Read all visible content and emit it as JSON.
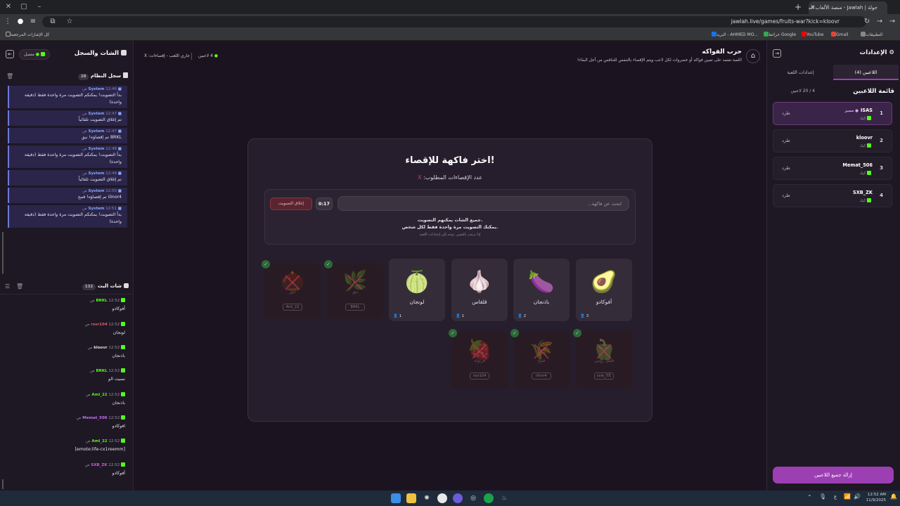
{
  "browser": {
    "tab_title": "جولة | Jawlah - منصة الألعاب الت...",
    "url": "jawlah.live/games/fruits-war?kick=kloovr",
    "bookmarks": [
      "التطبيقات",
      "Gmail",
      "YouTube",
      "خرائط Google",
      "البريد - AHMED MO...",
      "كل الإشارات المرجعية"
    ]
  },
  "left_panel": {
    "title": "الشات والسجل",
    "status": "متصل",
    "system_log_title": "سجل النظام",
    "system_log_count": "28",
    "system_messages": [
      {
        "sender": "System",
        "time": "12:46 ص",
        "text": "بدأ التصويت! يمكنكم التصويت مرة واحدة فقط (دقيقة واحدة)"
      },
      {
        "sender": "System",
        "time": "12:47 ص",
        "text": "تم إغلاق التصويت تلقائياً"
      },
      {
        "sender": "System",
        "time": "12:47 ص",
        "text": "BRKL تم إقصاؤه! نبق"
      },
      {
        "sender": "System",
        "time": "12:48 ص",
        "text": "بدأ التصويت! يمكنكم التصويت مرة واحدة فقط (دقيقة واحدة)"
      },
      {
        "sender": "System",
        "time": "12:49 ص",
        "text": "تم إغلاق التصويت تلقائياً"
      },
      {
        "sender": "System",
        "time": "12:50 ص",
        "text": "ilinor4 تم إقصاؤه! قمح"
      },
      {
        "sender": "System",
        "time": "12:51 ص",
        "text": "بدأ التصويت! يمكنكم التصويت مرة واحدة فقط (دقيقة واحدة)"
      }
    ],
    "live_chat_title": "شات البث",
    "live_chat_count": "132",
    "chat_messages": [
      {
        "user": "BRKL",
        "color": "#53fc18",
        "time": "12:52 ص",
        "text": "أفوكادو"
      },
      {
        "user": "rssr104",
        "color": "#d06060",
        "time": "12:52 ص",
        "text": "لونجان"
      },
      {
        "user": "kloovr",
        "color": "#e0e0e0",
        "time": "12:52 ص",
        "text": "باذنجان"
      },
      {
        "user": "BRKL",
        "color": "#53fc18",
        "time": "12:52 ص",
        "text": "نسيت الو"
      },
      {
        "user": "Aml_22",
        "color": "#53fc18",
        "time": "12:52 ص",
        "text": "باذنجان"
      },
      {
        "user": "Memat_506",
        "color": "#c070f0",
        "time": "12:52 ص",
        "text": "افوكادو"
      },
      {
        "user": "Aml_22",
        "color": "#53fc18",
        "time": "12:52 ص",
        "text": "[emote:life-cx1reemm]"
      },
      {
        "user": "SXB_ZK",
        "color": "#d05ad0",
        "time": "12:52 ص",
        "text": "أفوكادو"
      }
    ]
  },
  "topbar": {
    "game_title": "حرب الفواكه",
    "game_desc": "اللعبة تعتمد على تعيين فواكه أو خضروات لكل لاعب ويتم الإقصاء بالتنفس للتنافس من أجل البقاء!",
    "players_online": "4 لاعبين",
    "status": "جاري اللعب - إقصاءات: X"
  },
  "vote": {
    "heading": "اختر فاكهة للإقصاء!",
    "required_label": "عدد الإقصاءات المطلوب:",
    "required_value": "X",
    "search_placeholder": "ابحث عن فاكهة...",
    "timer": "0:17",
    "close_button": "إغلاق التصويت",
    "note1": "جميع الشات يمكنهم التصويت.",
    "note2": "يمكنك التصويت مرة واحدة فقط لكل شخص.",
    "note3": "إذا ترغب بالتغيير، توجه إلى إعدادات اللعبة"
  },
  "fruits": [
    {
      "name": "أفوكادو",
      "emoji": "🥑",
      "votes": "3"
    },
    {
      "name": "باذنجان",
      "emoji": "🍆",
      "votes": "2"
    },
    {
      "name": "قلقاس",
      "emoji": "🧄",
      "votes": "1"
    },
    {
      "name": "لونجان",
      "emoji": "🍈",
      "votes": "1"
    }
  ],
  "eliminated_row1": [
    {
      "name": "نبق",
      "emoji": "🌿",
      "player": "BRKL"
    },
    {
      "name": "جوز",
      "emoji": "🌰",
      "player": "Aml_22"
    }
  ],
  "eliminated_row2": [
    {
      "name": "فلفل رومي",
      "emoji": "🫑",
      "player": "sxle_ITE"
    },
    {
      "name": "قمح",
      "emoji": "🌾",
      "player": "ilinor4"
    },
    {
      "name": "فراولة",
      "emoji": "🍓",
      "player": "rssr104"
    }
  ],
  "right_panel": {
    "title": "الإعدادات",
    "tab_players": "اللاعبين (4)",
    "tab_settings": "إعدادات اللعبة",
    "list_title": "قائمة اللاعبين",
    "list_count": "4 / 20 لاعبين",
    "kick_label": "طرد",
    "platform": "كيك",
    "special_label": "مميز",
    "players": [
      {
        "num": "1",
        "name": "ISAS",
        "special": true
      },
      {
        "num": "2",
        "name": "kloovr",
        "special": false
      },
      {
        "num": "3",
        "name": "Memat_506",
        "special": false
      },
      {
        "num": "4",
        "name": "SXB_ZK",
        "special": false
      }
    ],
    "clear_all": "إزالة جميع اللاعبين"
  },
  "taskbar": {
    "time": "12:52 AM",
    "date": "11/9/2025",
    "lang": "ع"
  },
  "colors": {
    "accent": "#9b3fb3",
    "kick_green": "#53fc18",
    "system_blue": "#6d7ad8"
  }
}
